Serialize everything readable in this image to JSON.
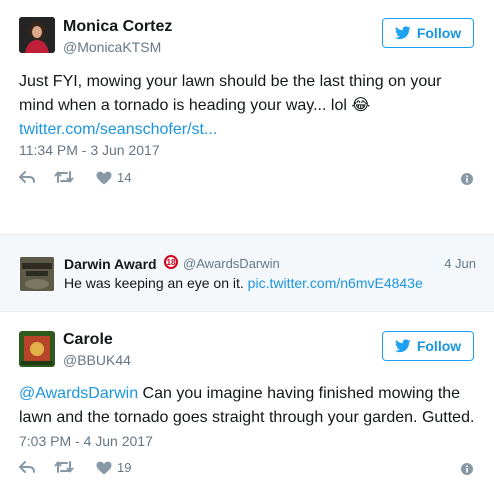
{
  "tweets": [
    {
      "name": "Monica Cortez",
      "handle": "@MonicaKTSM",
      "follow_label": "Follow",
      "text": "Just FYI, mowing your lawn should be the last thing on your mind when a tornado is heading your way... lol",
      "emoji": "😂",
      "link": "twitter.com/seanschofer/st...",
      "timestamp": "11:34 PM - 3 Jun 2017",
      "likes": "14"
    },
    {
      "name": "Carole",
      "handle": "@BBUK44",
      "follow_label": "Follow",
      "mention": "@AwardsDarwin",
      "text": "Can you imagine having finished mowing the lawn and the tornado goes straight through your garden. Gutted.",
      "timestamp": "7:03 PM - 4 Jun 2017",
      "likes": "19"
    }
  ],
  "quoted": {
    "name": "Darwin Award",
    "badge": "18",
    "handle": "@AwardsDarwin",
    "date": "4 Jun",
    "text": "He was keeping an eye on it.",
    "link": "pic.twitter.com/n6mvE4843e",
    "avatar_text": "THINNING THE HERD"
  },
  "colors": {
    "twitter_blue": "#1da1f2",
    "link_blue": "#1b95e0",
    "muted": "#657786",
    "text": "#14171a",
    "quote_bg": "#f5f8fa"
  }
}
